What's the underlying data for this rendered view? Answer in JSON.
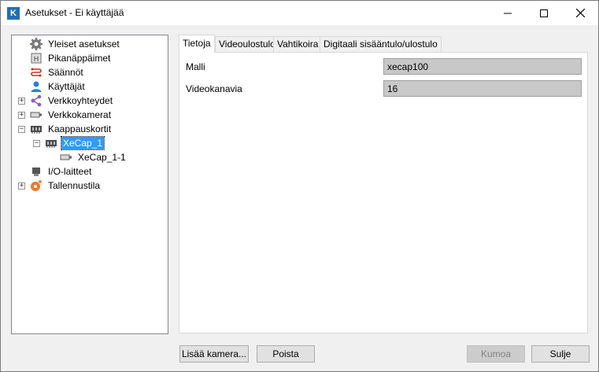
{
  "window": {
    "title": "Asetukset - Ei käyttäjää",
    "app_icon_letter": "K"
  },
  "tree": {
    "items": [
      {
        "label": "Yleiset asetukset",
        "icon": "gear-icon"
      },
      {
        "label": "Pikanäppäimet",
        "icon": "hotkey-icon"
      },
      {
        "label": "Säännöt",
        "icon": "rules-icon"
      },
      {
        "label": "Käyttäjät",
        "icon": "user-icon"
      },
      {
        "label": "Verkkoyhteydet",
        "icon": "network-icon",
        "expander": "+"
      },
      {
        "label": "Verkkokamerat",
        "icon": "camera-icon",
        "expander": "+"
      },
      {
        "label": "Kaappauskortit",
        "icon": "capture-card-icon",
        "expander": "−"
      },
      {
        "label": "XeCap_1",
        "icon": "capture-card-icon",
        "expander": "−",
        "selected": true
      },
      {
        "label": "XeCap_1-1",
        "icon": "camera-icon"
      },
      {
        "label": "I/O-laitteet",
        "icon": "io-device-icon"
      },
      {
        "label": "Tallennustila",
        "icon": "storage-icon",
        "expander": "+"
      }
    ]
  },
  "tabs": [
    {
      "label": "Tietoja",
      "active": true
    },
    {
      "label": "Videoulostulo"
    },
    {
      "label": "Vahtikoira"
    },
    {
      "label": "Digitaali sisääntulo/ulostulo"
    }
  ],
  "fields": {
    "model": {
      "label": "Malli",
      "value": "xecap100"
    },
    "channels": {
      "label": "Videokanavia",
      "value": "16"
    }
  },
  "buttons": {
    "add_camera": "Lisää kamera...",
    "delete": "Poista",
    "undo": "Kumoa",
    "close": "Sulje"
  },
  "colors": {
    "selection": "#3399ff",
    "app_icon": "#1f6fb5"
  }
}
